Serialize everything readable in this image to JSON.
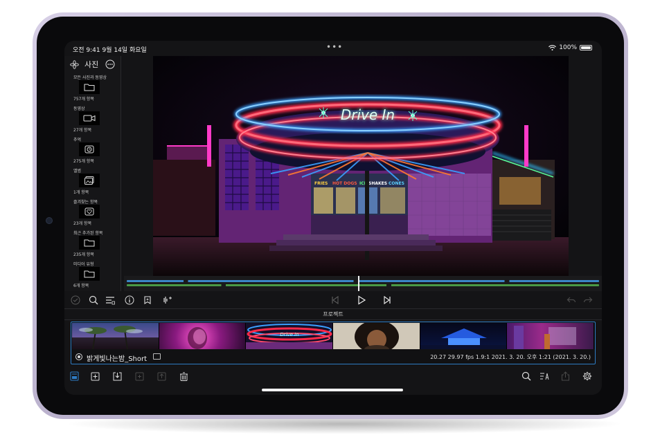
{
  "status": {
    "time_date": "오전 9:41 9월 14일 화요일",
    "dots": "•••",
    "battery_pct": "100%"
  },
  "sidebar": {
    "title": "사진",
    "items": [
      {
        "category": "모든 사진과 동영상",
        "count": "757개 항목",
        "icon": "folder-icon"
      },
      {
        "category": "동영상",
        "count": "27개 항목",
        "icon": "video-camera-icon"
      },
      {
        "category": "추억",
        "count": "275개 항목",
        "icon": "memories-icon"
      },
      {
        "category": "앨범",
        "count": "1개 항목",
        "icon": "album-icon"
      },
      {
        "category": "즐겨찾는 항목",
        "count": "23개 항목",
        "icon": "heart-icon"
      },
      {
        "category": "최근 추가된 항목",
        "count": "235개 항목",
        "icon": "folder-icon"
      },
      {
        "category": "미디어 유형",
        "count": "6개 항목",
        "icon": "folder-icon"
      }
    ]
  },
  "viewer": {
    "sign_text": "Drive In",
    "window_labels": [
      "FRIES",
      "HOT DOGS",
      "ICE",
      "SHAKES",
      "CONES"
    ]
  },
  "project_section_label": "프로젝트",
  "project": {
    "name": "밝게빛나는밤_Short",
    "meta": "20.27   29.97 fps   1.9:1   2021. 3. 20. 오후 1:21   (2021. 3. 20.)"
  },
  "timeline": {
    "playhead_fraction": 0.49
  },
  "colors": {
    "accent": "#2e7cc4",
    "timeline_blue": "#3a86c8",
    "timeline_green": "#4a9a46",
    "neon_red": "#ff2a4a",
    "neon_blue": "#3aa0ff",
    "neon_pink": "#ff3ac8"
  }
}
